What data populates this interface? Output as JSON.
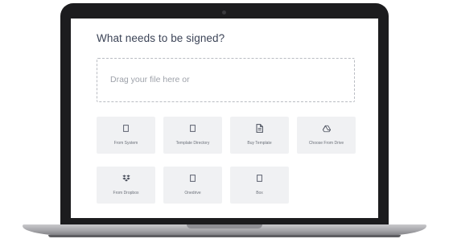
{
  "upload": {
    "heading": "What needs to be signed?",
    "dropzone_text": "Drag your file here  or"
  },
  "sources": [
    {
      "label": "From System",
      "icon": "file-icon"
    },
    {
      "label": "Template Directory",
      "icon": "file-icon"
    },
    {
      "label": "Buy Template",
      "icon": "document-icon"
    },
    {
      "label": "Choose From Drive",
      "icon": "google-drive-icon"
    },
    {
      "label": "From Dropbox",
      "icon": "dropbox-icon"
    },
    {
      "label": "Onedrive",
      "icon": "file-icon"
    },
    {
      "label": "Box",
      "icon": "file-icon"
    }
  ]
}
